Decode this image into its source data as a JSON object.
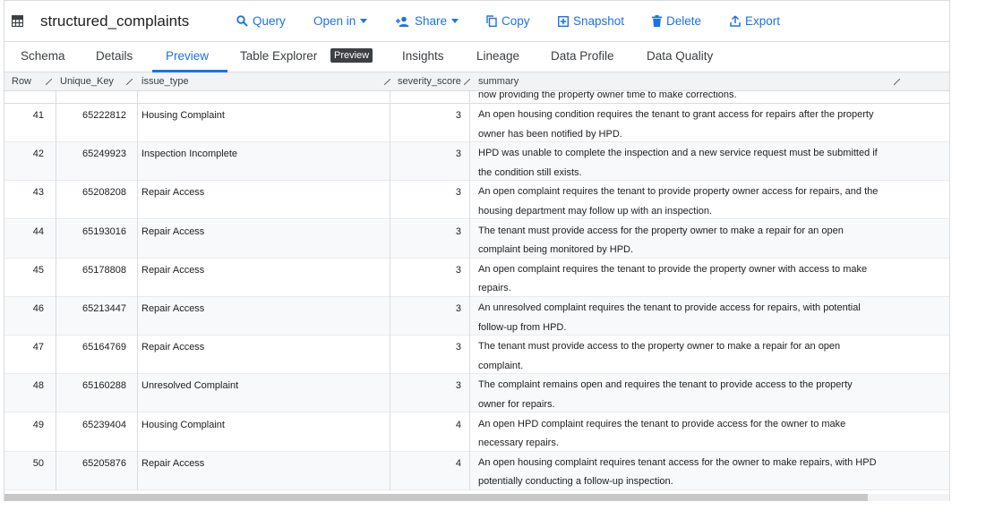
{
  "toolbar": {
    "title": "structured_complaints",
    "query": "Query",
    "open_in": "Open in",
    "share": "Share",
    "copy": "Copy",
    "snapshot": "Snapshot",
    "delete": "Delete",
    "export": "Export"
  },
  "tabs": {
    "schema": "Schema",
    "details": "Details",
    "preview": "Preview",
    "table_explorer": "Table Explorer",
    "preview_badge": "Preview",
    "insights": "Insights",
    "lineage": "Lineage",
    "data_profile": "Data Profile",
    "data_quality": "Data Quality"
  },
  "grid": {
    "headers": {
      "row": "Row",
      "unique_key": "Unique_Key",
      "issue_type": "issue_type",
      "severity_score": "severity_score",
      "summary": "summary"
    },
    "partial_summary": "now providing the property owner time to make corrections.",
    "rows": [
      {
        "row": "41",
        "key": "65222812",
        "issue": "Housing Complaint",
        "sev": "3",
        "summary": "An open housing condition requires the tenant to grant access for repairs after the property owner has been notified by HPD."
      },
      {
        "row": "42",
        "key": "65249923",
        "issue": "Inspection Incomplete",
        "sev": "3",
        "summary": "HPD was unable to complete the inspection and a new service request must be submitted if the condition still exists."
      },
      {
        "row": "43",
        "key": "65208208",
        "issue": "Repair Access",
        "sev": "3",
        "summary": "An open complaint requires the tenant to provide property owner access for repairs, and the housing department may follow up with an inspection."
      },
      {
        "row": "44",
        "key": "65193016",
        "issue": "Repair Access",
        "sev": "3",
        "summary": "The tenant must provide access for the property owner to make a repair for an open complaint being monitored by HPD."
      },
      {
        "row": "45",
        "key": "65178808",
        "issue": "Repair Access",
        "sev": "3",
        "summary": "An open complaint requires the tenant to provide the property owner with access to make repairs."
      },
      {
        "row": "46",
        "key": "65213447",
        "issue": "Repair Access",
        "sev": "3",
        "summary": "An unresolved complaint requires the tenant to provide access for repairs, with potential follow-up from HPD."
      },
      {
        "row": "47",
        "key": "65164769",
        "issue": "Repair Access",
        "sev": "3",
        "summary": "The tenant must provide access to the property owner to make a repair for an open complaint."
      },
      {
        "row": "48",
        "key": "65160288",
        "issue": "Unresolved Complaint",
        "sev": "3",
        "summary": "The complaint remains open and requires the tenant to provide access to the property owner for repairs."
      },
      {
        "row": "49",
        "key": "65239404",
        "issue": "Housing Complaint",
        "sev": "4",
        "summary": "An open HPD complaint requires the tenant to provide access for the owner to make necessary repairs."
      },
      {
        "row": "50",
        "key": "65205876",
        "issue": "Repair Access",
        "sev": "4",
        "summary": "An open housing complaint requires tenant access for the owner to make repairs, with HPD potentially conducting a follow-up inspection."
      }
    ]
  },
  "colors": {
    "accent": "#1a73e8",
    "delete": "#1a73e8",
    "border": "#dadce0"
  }
}
